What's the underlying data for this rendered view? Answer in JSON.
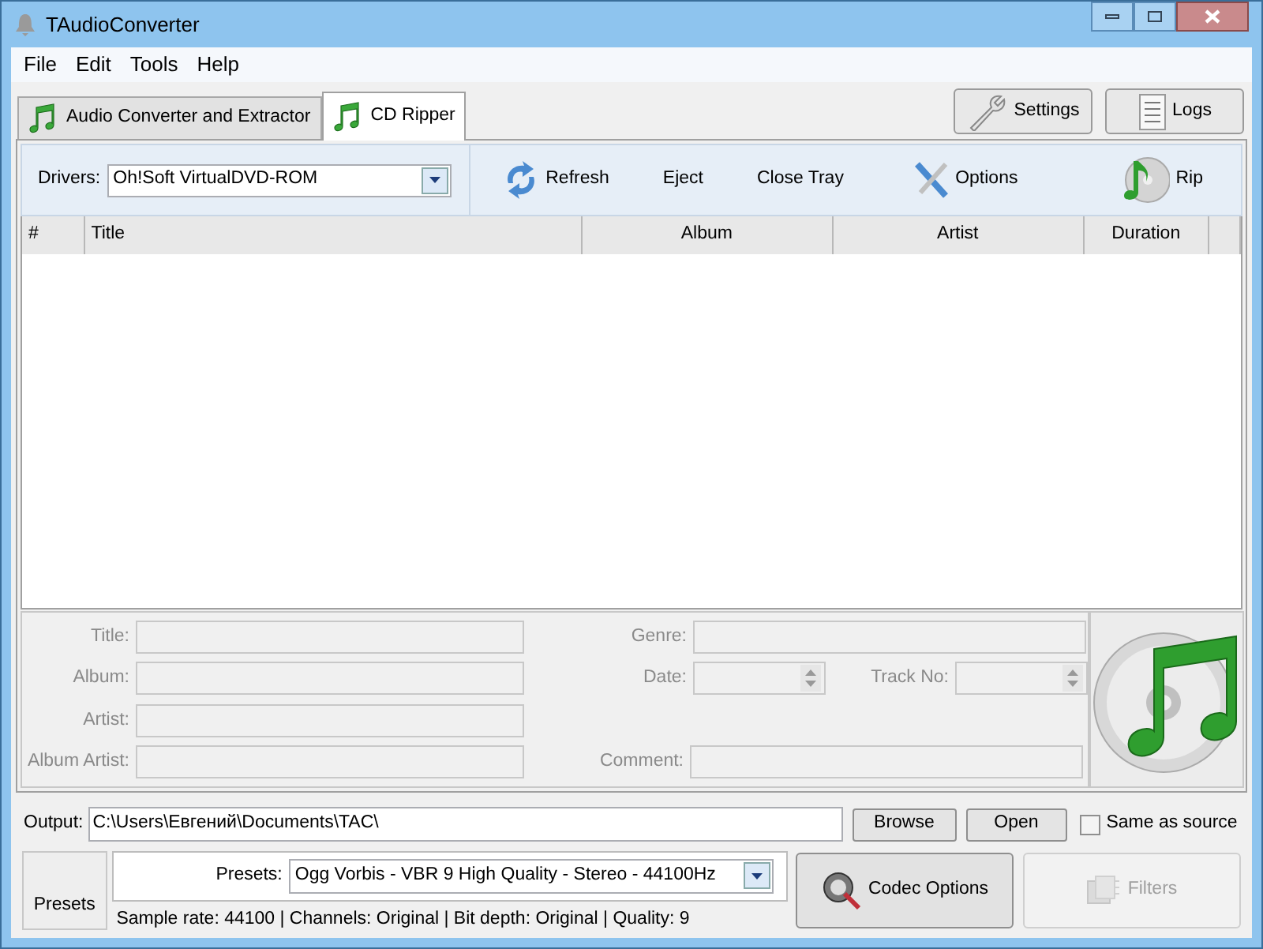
{
  "window": {
    "title": "TAudioConverter"
  },
  "menu": [
    "File",
    "Edit",
    "Tools",
    "Help"
  ],
  "tabs": [
    {
      "label": "Audio Converter and Extractor",
      "selected": false
    },
    {
      "label": "CD Ripper",
      "selected": true
    }
  ],
  "top_buttons": [
    {
      "label": "Settings",
      "kind": "settings"
    },
    {
      "label": "Logs",
      "kind": "logs"
    }
  ],
  "drivers": {
    "label": "Drivers:",
    "value": "Oh!Soft VirtualDVD-ROM"
  },
  "toolbar": [
    {
      "label": "Refresh",
      "kind": "refresh"
    },
    {
      "label": "Eject",
      "kind": "plain"
    },
    {
      "label": "Close Tray",
      "kind": "plain"
    },
    {
      "label": "Options",
      "kind": "options"
    },
    {
      "label": "Rip",
      "kind": "rip"
    }
  ],
  "table": {
    "columns": [
      "#",
      "Title",
      "Album",
      "Artist",
      "Duration"
    ]
  },
  "tag_rows": [
    [
      {
        "label": "Title:",
        "kind": "text",
        "disabled": true
      },
      {
        "label": "Genre:",
        "kind": "text",
        "disabled": true
      }
    ],
    [
      {
        "label": "Album:",
        "kind": "text",
        "disabled": true
      },
      {
        "label": "Date:",
        "kind": "spin",
        "disabled": true
      },
      {
        "label": "Track No:",
        "kind": "spin",
        "disabled": true
      }
    ],
    [
      {
        "label": "Artist:",
        "kind": "text",
        "disabled": true
      }
    ],
    [
      {
        "label": "Album Artist:",
        "kind": "text",
        "disabled": true
      },
      {
        "label": "Comment:",
        "kind": "text",
        "disabled": true
      }
    ]
  ],
  "output": {
    "label": "Output:",
    "value": "C:\\Users\\Евгений\\Documents\\TAC\\",
    "buttons": [
      "Browse",
      "Open"
    ],
    "same_as_source": {
      "label": "Same as source",
      "checked": false
    }
  },
  "presets_button": "Presets",
  "presets": {
    "label": "Presets:",
    "value": "Ogg Vorbis - VBR 9 High Quality - Stereo - 44100Hz"
  },
  "info": "Sample rate: 44100 | Channels: Original | Bit depth: Original | Quality: 9",
  "codec_button": {
    "label": "Codec Options",
    "disabled": false
  },
  "filters_button": {
    "label": "Filters",
    "disabled": true
  }
}
